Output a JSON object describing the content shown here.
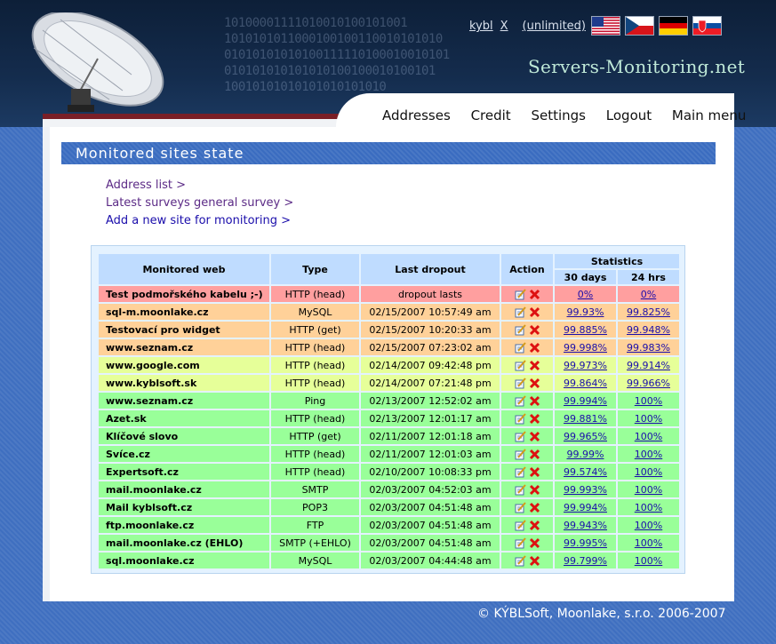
{
  "header": {
    "binary_lines": [
      "10100001111010010100101001",
      "1010101011000100100110010101010",
      "01010101010100111110100010010101",
      "010101010101010100100010100101",
      "10010101010101010101010"
    ],
    "user": {
      "name": "kybl",
      "close": "X",
      "plan": "(unlimited)"
    },
    "flags": [
      "us-flag-icon",
      "cz-flag-icon",
      "de-flag-icon",
      "sk-flag-icon"
    ],
    "brand": "Servers-Monitoring.net"
  },
  "menu": [
    "Addresses",
    "Credit",
    "Settings",
    "Logout",
    "Main menu"
  ],
  "section_title": "Monitored sites state",
  "links": [
    {
      "label": "Address list >",
      "visited": true
    },
    {
      "label": "Latest surveys general survey >",
      "visited": true
    },
    {
      "label": "Add a new site for monitoring >",
      "visited": false
    }
  ],
  "table": {
    "headers": {
      "web": "Monitored web",
      "type": "Type",
      "dropout": "Last dropout",
      "action": "Action",
      "stats": "Statistics",
      "d30": "30 days",
      "h24": "24 hrs"
    },
    "rows": [
      {
        "name": "Test podmořského kabelu ;-)",
        "type": "HTTP (head)",
        "dropout": "dropout lasts",
        "d30": "0%",
        "h24": "0%",
        "status": "red"
      },
      {
        "name": "sql-m.moonlake.cz",
        "type": "MySQL",
        "dropout": "02/15/2007 10:57:49 am",
        "d30": "99.93%",
        "h24": "99.825%",
        "status": "orange"
      },
      {
        "name": "Testovací pro widget",
        "type": "HTTP (get)",
        "dropout": "02/15/2007 10:20:33 am",
        "d30": "99.885%",
        "h24": "99.948%",
        "status": "orange"
      },
      {
        "name": "www.seznam.cz",
        "type": "HTTP (head)",
        "dropout": "02/15/2007 07:23:02 am",
        "d30": "99.998%",
        "h24": "99.983%",
        "status": "orange"
      },
      {
        "name": "www.google.com",
        "type": "HTTP (head)",
        "dropout": "02/14/2007 09:42:48 pm",
        "d30": "99.973%",
        "h24": "99.914%",
        "status": "yellow"
      },
      {
        "name": "www.kyblsoft.sk",
        "type": "HTTP (head)",
        "dropout": "02/14/2007 07:21:48 pm",
        "d30": "99.864%",
        "h24": "99.966%",
        "status": "yellow"
      },
      {
        "name": "www.seznam.cz",
        "type": "Ping",
        "dropout": "02/13/2007 12:52:02 am",
        "d30": "99.994%",
        "h24": "100%",
        "status": "green"
      },
      {
        "name": "Azet.sk",
        "type": "HTTP (head)",
        "dropout": "02/13/2007 12:01:17 am",
        "d30": "99.881%",
        "h24": "100%",
        "status": "green"
      },
      {
        "name": "Klíčové slovo",
        "type": "HTTP (get)",
        "dropout": "02/11/2007 12:01:18 am",
        "d30": "99.965%",
        "h24": "100%",
        "status": "green"
      },
      {
        "name": "Svíce.cz",
        "type": "HTTP (head)",
        "dropout": "02/11/2007 12:01:03 am",
        "d30": "99.99%",
        "h24": "100%",
        "status": "green"
      },
      {
        "name": "Expertsoft.cz",
        "type": "HTTP (head)",
        "dropout": "02/10/2007 10:08:33 pm",
        "d30": "99.574%",
        "h24": "100%",
        "status": "green"
      },
      {
        "name": "mail.moonlake.cz",
        "type": "SMTP",
        "dropout": "02/03/2007 04:52:03 am",
        "d30": "99.993%",
        "h24": "100%",
        "status": "green"
      },
      {
        "name": "Mail kyblsoft.cz",
        "type": "POP3",
        "dropout": "02/03/2007 04:51:48 am",
        "d30": "99.994%",
        "h24": "100%",
        "status": "green"
      },
      {
        "name": "ftp.moonlake.cz",
        "type": "FTP",
        "dropout": "02/03/2007 04:51:48 am",
        "d30": "99.943%",
        "h24": "100%",
        "status": "green"
      },
      {
        "name": "mail.moonlake.cz (EHLO)",
        "type": "SMTP (+EHLO)",
        "dropout": "02/03/2007 04:51:48 am",
        "d30": "99.995%",
        "h24": "100%",
        "status": "green"
      },
      {
        "name": "sql.moonlake.cz",
        "type": "MySQL",
        "dropout": "02/03/2007 04:44:48 am",
        "d30": "99.799%",
        "h24": "100%",
        "status": "green"
      }
    ],
    "row_actions": [
      "edit-icon",
      "delete-icon"
    ]
  },
  "colors": {
    "red": "#ff9f9f",
    "orange": "#ffd199",
    "yellow": "#e6ff99",
    "green": "#99ff99",
    "header_cell": "#bfdcff",
    "accent": "#3a6cc0"
  },
  "footer": "© KÝBLSoft, Moonlake, s.r.o. 2006-2007"
}
